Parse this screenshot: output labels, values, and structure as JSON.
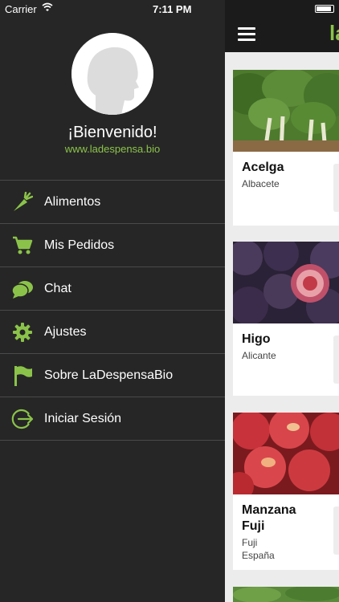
{
  "status": {
    "carrier": "Carrier",
    "time": "7:11 PM"
  },
  "drawer": {
    "welcome": "¡Bienvenido!",
    "website": "www.ladespensa.bio",
    "menu": [
      {
        "label": "Alimentos",
        "icon": "carrot-icon"
      },
      {
        "label": "Mis Pedidos",
        "icon": "cart-icon"
      },
      {
        "label": "Chat",
        "icon": "chat-icon"
      },
      {
        "label": "Ajustes",
        "icon": "gear-icon"
      },
      {
        "label": "Sobre LaDespensaBio",
        "icon": "flag-icon"
      },
      {
        "label": "Iniciar Sesión",
        "icon": "login-icon"
      }
    ]
  },
  "topbar": {
    "brand": "la"
  },
  "products": [
    {
      "name": "Acelga",
      "line1": "Albacete",
      "line2": ""
    },
    {
      "name": "Higo",
      "line1": "Alicante",
      "line2": ""
    },
    {
      "name": "Manzana Fuji",
      "line1": "Fuji",
      "line2": "España"
    }
  ],
  "colors": {
    "accent": "#8bc34a",
    "drawer_bg": "#262626",
    "topbar_bg": "#1b1b1b"
  }
}
